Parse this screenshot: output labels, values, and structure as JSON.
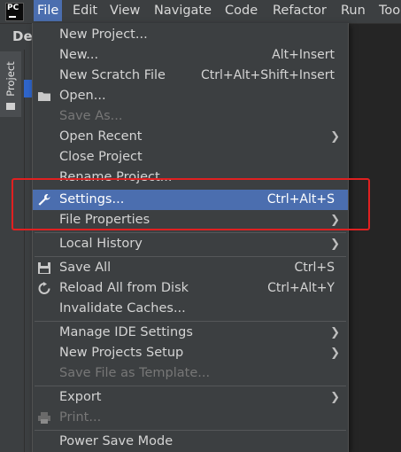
{
  "menubar": {
    "logo_text": "PC",
    "items": [
      "File",
      "Edit",
      "View",
      "Navigate",
      "Code",
      "Refactor",
      "Run",
      "Too"
    ],
    "active_index": 0
  },
  "sidebar": {
    "project_tab_label": "Project",
    "breadcrumb": "De"
  },
  "file_menu": {
    "items": [
      {
        "label": "New Project...",
        "shortcut": "",
        "submenu": false,
        "disabled": false
      },
      {
        "label": "New...",
        "shortcut": "Alt+Insert",
        "submenu": false,
        "disabled": false
      },
      {
        "label": "New Scratch File",
        "shortcut": "Ctrl+Alt+Shift+Insert",
        "submenu": false,
        "disabled": false
      },
      {
        "label": "Open...",
        "shortcut": "",
        "submenu": false,
        "disabled": false,
        "icon": "folder-icon"
      },
      {
        "label": "Save As...",
        "shortcut": "",
        "submenu": false,
        "disabled": true
      },
      {
        "label": "Open Recent",
        "shortcut": "",
        "submenu": true,
        "disabled": false
      },
      {
        "label": "Close Project",
        "shortcut": "",
        "submenu": false,
        "disabled": false
      },
      {
        "label": "Rename Project...",
        "shortcut": "",
        "submenu": false,
        "disabled": false
      },
      {
        "label": "Settings...",
        "shortcut": "Ctrl+Alt+S",
        "submenu": false,
        "disabled": false,
        "highlighted": true,
        "icon": "wrench-icon"
      },
      {
        "label": "File Properties",
        "shortcut": "",
        "submenu": true,
        "disabled": false
      },
      {
        "label": "Local History",
        "shortcut": "",
        "submenu": true,
        "disabled": false
      },
      {
        "label": "Save All",
        "shortcut": "Ctrl+S",
        "submenu": false,
        "disabled": false,
        "icon": "save-icon"
      },
      {
        "label": "Reload All from Disk",
        "shortcut": "Ctrl+Alt+Y",
        "submenu": false,
        "disabled": false,
        "icon": "reload-icon"
      },
      {
        "label": "Invalidate Caches...",
        "shortcut": "",
        "submenu": false,
        "disabled": false
      },
      {
        "label": "Manage IDE Settings",
        "shortcut": "",
        "submenu": true,
        "disabled": false
      },
      {
        "label": "New Projects Setup",
        "shortcut": "",
        "submenu": true,
        "disabled": false
      },
      {
        "label": "Save File as Template...",
        "shortcut": "",
        "submenu": false,
        "disabled": true
      },
      {
        "label": "Export",
        "shortcut": "",
        "submenu": true,
        "disabled": false
      },
      {
        "label": "Print...",
        "shortcut": "",
        "submenu": false,
        "disabled": true,
        "icon": "print-icon"
      },
      {
        "label": "Power Save Mode",
        "shortcut": "",
        "submenu": false,
        "disabled": false
      }
    ]
  },
  "colors": {
    "highlight": "#4b6eaf",
    "annotation_box": "#e02020"
  }
}
